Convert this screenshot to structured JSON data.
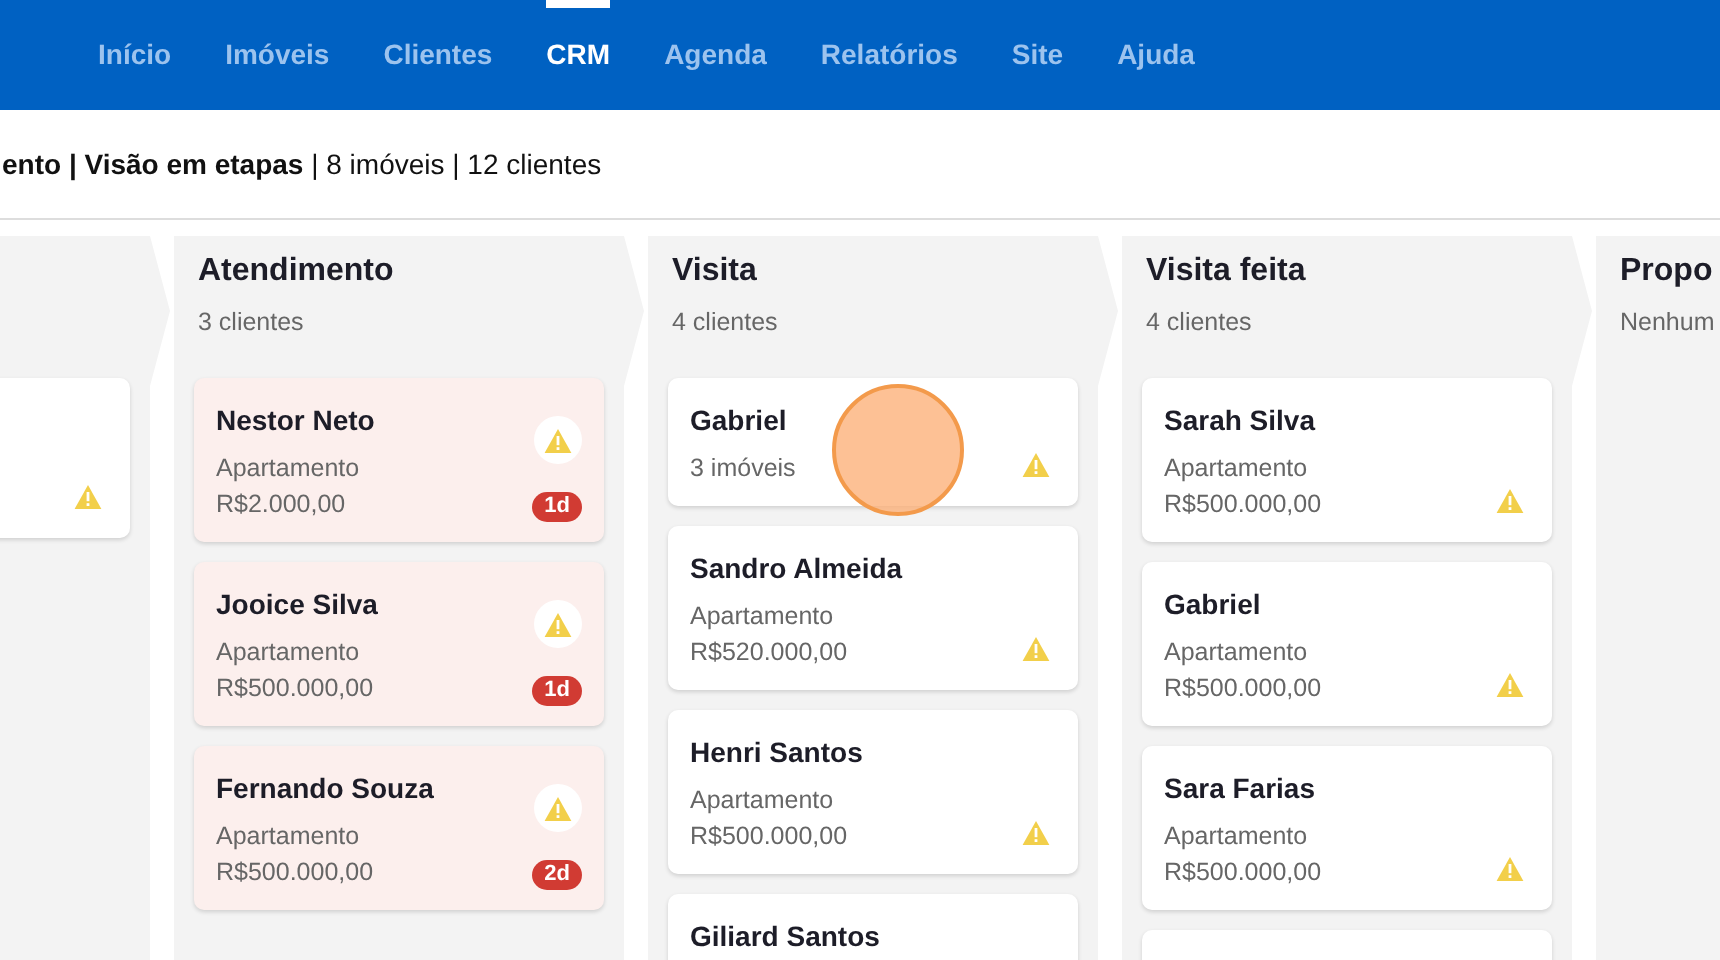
{
  "nav": [
    {
      "label": "Início",
      "selected": false
    },
    {
      "label": "Imóveis",
      "selected": false
    },
    {
      "label": "Clientes",
      "selected": false
    },
    {
      "label": "CRM",
      "selected": true
    },
    {
      "label": "Agenda",
      "selected": false
    },
    {
      "label": "Relatórios",
      "selected": false
    },
    {
      "label": "Site",
      "selected": false
    },
    {
      "label": "Ajuda",
      "selected": false
    }
  ],
  "breadcrumb": "**ento | Visão em etapas** | 8 imóveis | 12 clientes",
  "columns": [
    {
      "cards": [
        {
          "overdue": false
        }
      ]
    },
    {
      "title": "Atendimento",
      "subtitle": "3 clientes",
      "cards": [
        {
          "name": "Nestor Neto",
          "lines": [
            "Apartamento",
            "R$2.000,00"
          ],
          "overdue": true,
          "age": "1d"
        },
        {
          "name": "Jooice Silva",
          "lines": [
            "Apartamento",
            "R$500.000,00"
          ],
          "overdue": true,
          "age": "1d"
        },
        {
          "name": "Fernando Souza",
          "lines": [
            "Apartamento",
            "R$500.000,00"
          ],
          "overdue": true,
          "age": "2d"
        }
      ]
    },
    {
      "title": "Visita",
      "subtitle": "4 clientes",
      "cards": [
        {
          "name": "Gabriel",
          "lines": [
            "3 imóveis"
          ],
          "overdue": false,
          "clicked": true
        },
        {
          "name": "Sandro Almeida",
          "lines": [
            "Apartamento",
            "R$520.000,00"
          ],
          "overdue": false
        },
        {
          "name": "Henri Santos",
          "lines": [
            "Apartamento",
            "R$500.000,00"
          ],
          "overdue": false
        },
        {
          "name": "Giliard Santos",
          "overdue": false
        }
      ]
    },
    {
      "title": "Visita feita",
      "subtitle": "4 clientes",
      "cards": [
        {
          "name": "Sarah Silva",
          "lines": [
            "Apartamento",
            "R$500.000,00"
          ],
          "overdue": false
        },
        {
          "name": "Gabriel",
          "lines": [
            "Apartamento",
            "R$500.000,00"
          ],
          "overdue": false
        },
        {
          "name": "Sara Farias",
          "lines": [
            "Apartamento",
            "R$500.000,00"
          ],
          "overdue": false
        },
        {
          "overdue": false
        }
      ]
    },
    {
      "title": "Propo",
      "subtitle": "Nenhum"
    }
  ]
}
